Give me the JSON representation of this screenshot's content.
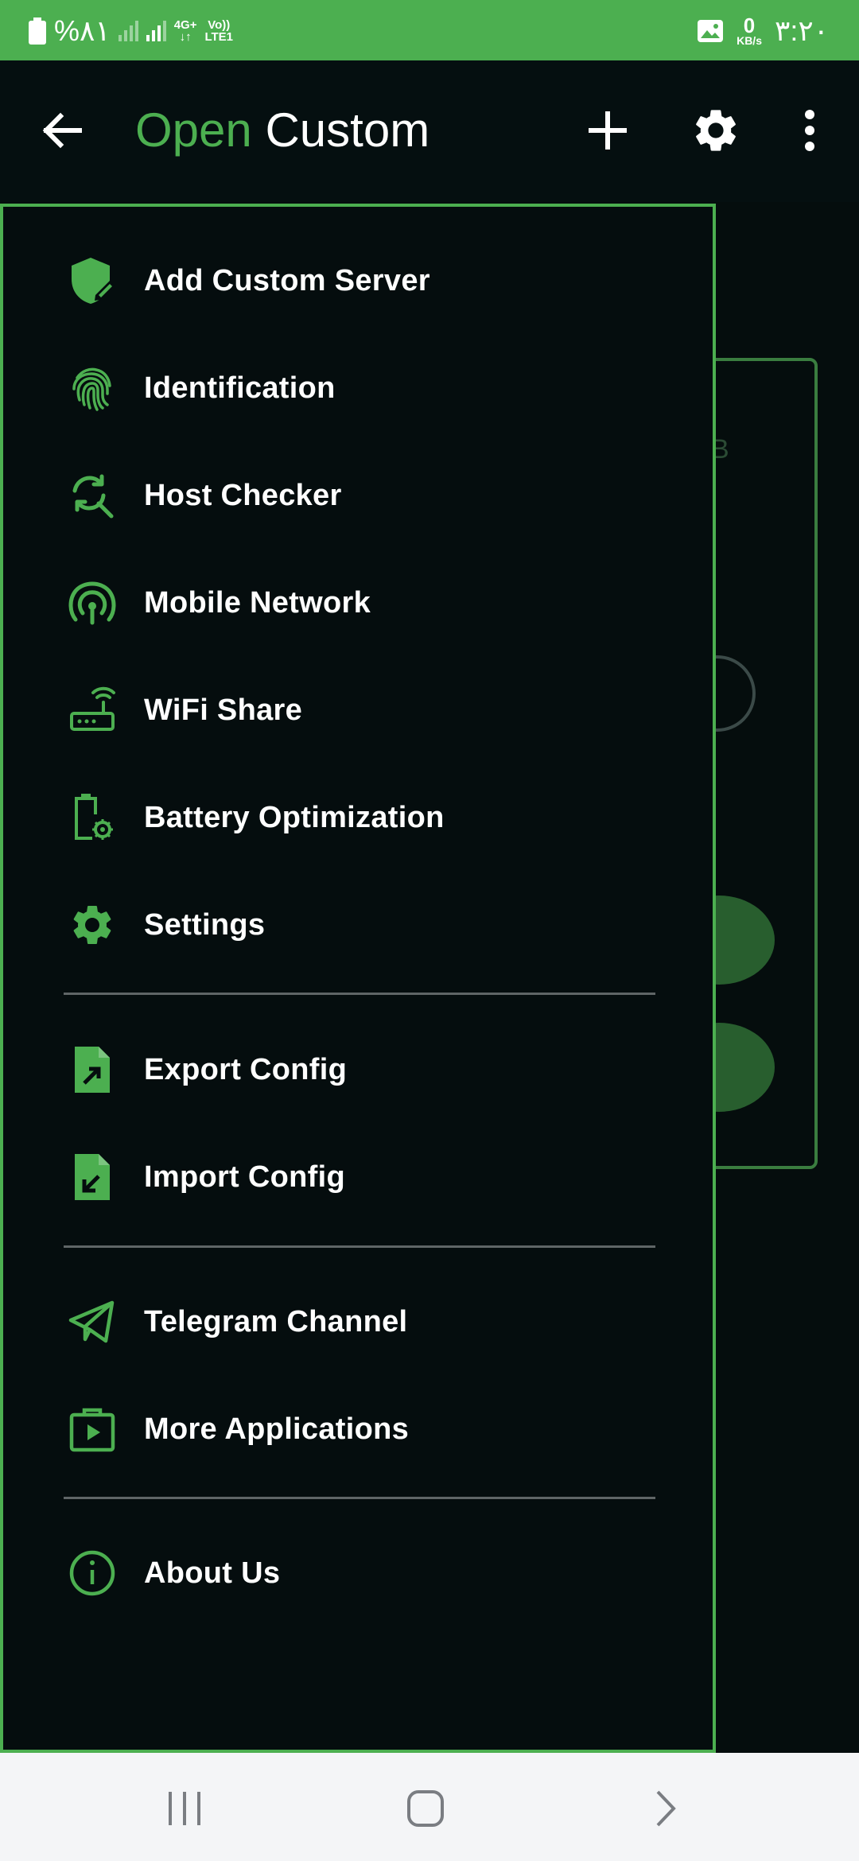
{
  "status_bar": {
    "battery_text": "%۸۱",
    "network_type": "4G+",
    "volte_label": "Vo))",
    "lte_label": "LTE1",
    "speed_value": "0",
    "speed_unit": "KB/s",
    "time": "۳:۲۰"
  },
  "toolbar": {
    "title_part1": "Open",
    "title_part2": "Custom",
    "accent_color": "#4caf50"
  },
  "drawer": {
    "items": [
      {
        "label": "Add Custom Server",
        "icon": "shield-edit-icon"
      },
      {
        "label": "Identification",
        "icon": "fingerprint-icon"
      },
      {
        "label": "Host Checker",
        "icon": "search-refresh-icon"
      },
      {
        "label": "Mobile Network",
        "icon": "signal-icon"
      },
      {
        "label": "WiFi Share",
        "icon": "router-icon"
      },
      {
        "label": "Battery Optimization",
        "icon": "battery-settings-icon"
      },
      {
        "label": "Settings",
        "icon": "gear-icon"
      },
      {
        "label": "Export Config",
        "icon": "file-export-icon"
      },
      {
        "label": "Import Config",
        "icon": "file-import-icon"
      },
      {
        "label": "Telegram Channel",
        "icon": "telegram-icon"
      },
      {
        "label": "More Applications",
        "icon": "play-store-icon"
      },
      {
        "label": "About Us",
        "icon": "info-icon"
      }
    ]
  },
  "background": {
    "partial_text": "B"
  }
}
